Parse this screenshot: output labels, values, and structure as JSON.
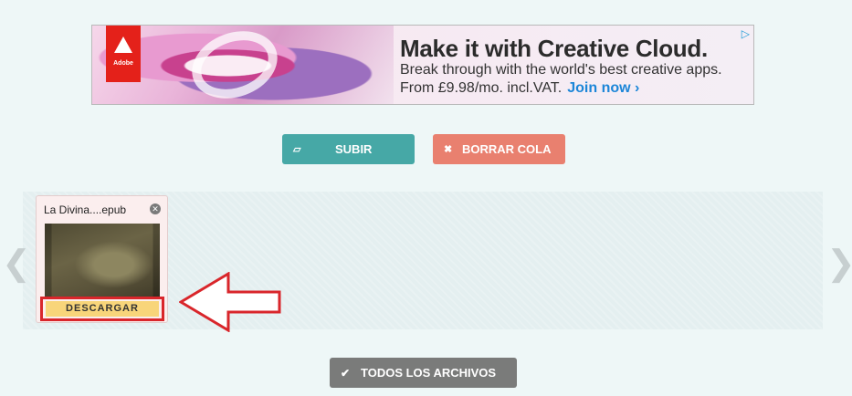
{
  "ad": {
    "brand": "Adobe",
    "headline": "Make it with Creative Cloud.",
    "line1": "Break through with the world's best creative apps.",
    "line2": "From £9.98/mo. incl.VAT.",
    "cta": "Join now ›",
    "choices_icon": "adchoices-icon"
  },
  "toolbar": {
    "upload_label": "SUBIR",
    "upload_icon": "folder-open-icon",
    "clear_label": "BORRAR COLA",
    "clear_icon": "close-icon"
  },
  "queue": {
    "nav_left": "❮",
    "nav_right": "❯",
    "files": [
      {
        "name": "La Divina....epub",
        "download_label": "DESCARGAR"
      }
    ]
  },
  "footer": {
    "all_files_label": "TODOS LOS ARCHIVOS",
    "all_files_icon": "check-icon"
  },
  "colors": {
    "upload": "#46a8a6",
    "clear": "#e9806f",
    "download": "#f8d57a",
    "annotation": "#d9262b",
    "all_files": "#7a7b7a"
  }
}
